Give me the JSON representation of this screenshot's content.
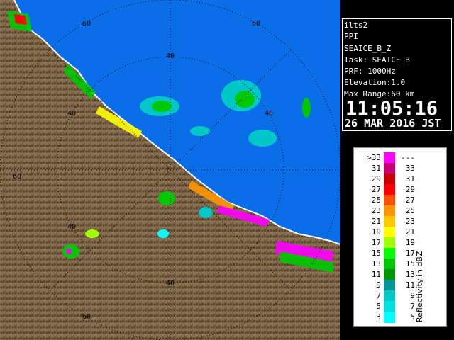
{
  "radar": {
    "station": "ilts2",
    "scan_type": "PPI",
    "product": "SEAICE_B_Z",
    "task": "Task: SEAICE_B",
    "prf": "PRF: 1000Hz",
    "elevation": "Elevation:1.0",
    "max_range": "Max Range:60 km",
    "time": "11:05:16",
    "date": "26 MAR 2016 JST"
  },
  "range_labels": [
    "60",
    "60",
    "40",
    "60",
    "40",
    "40",
    "40",
    "40",
    "60"
  ],
  "legend": {
    "title": "Reflectivity in dBZ",
    "rows": [
      {
        "low": ">33",
        "high": "---",
        "color": "#ff00ff"
      },
      {
        "low": "31",
        "high": "33",
        "color": "#c80078"
      },
      {
        "low": "29",
        "high": "31",
        "color": "#c80000"
      },
      {
        "low": "27",
        "high": "29",
        "color": "#ff0000"
      },
      {
        "low": "25",
        "high": "27",
        "color": "#ff5000"
      },
      {
        "low": "23",
        "high": "25",
        "color": "#ff9600"
      },
      {
        "low": "21",
        "high": "23",
        "color": "#ffc800"
      },
      {
        "low": "19",
        "high": "21",
        "color": "#ffff00"
      },
      {
        "low": "17",
        "high": "19",
        "color": "#a0ff00"
      },
      {
        "low": "15",
        "high": "17",
        "color": "#00ff00"
      },
      {
        "low": "13",
        "high": "15",
        "color": "#00c800"
      },
      {
        "low": "11",
        "high": "13",
        "color": "#009600"
      },
      {
        "low": "9",
        "high": "11",
        "color": "#009696"
      },
      {
        "low": "7",
        "high": "9",
        "color": "#00c8c8"
      },
      {
        "low": "5",
        "high": "7",
        "color": "#00e0e0"
      },
      {
        "low": "3",
        "high": "5",
        "color": "#00ffff"
      }
    ]
  },
  "colors": {
    "sea": "#0a6ee8",
    "land": "#7a6244",
    "land_dark": "#4f3d28",
    "coast": "#ffffff"
  }
}
